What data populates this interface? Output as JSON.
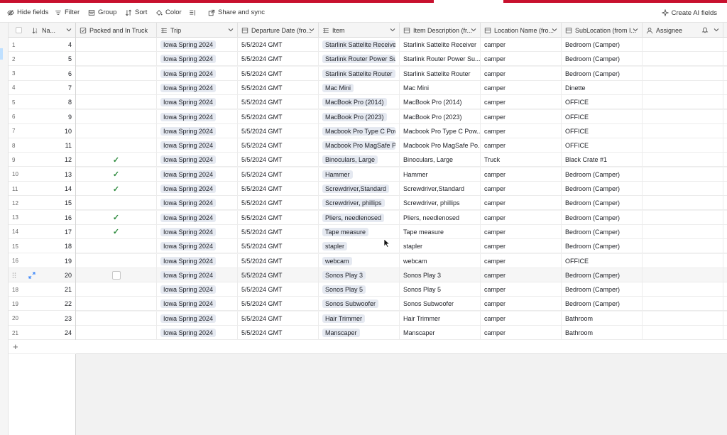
{
  "toolbar": {
    "hide_fields": "Hide fields",
    "filter": "Filter",
    "group": "Group",
    "sort": "Sort",
    "color": "Color",
    "share": "Share and sync",
    "create_ai": "Create AI fields"
  },
  "columns": {
    "name": "Na...",
    "packed": "Packed and In Truck",
    "trip": "Trip",
    "date": "Departure Date (fro...",
    "item": "Item",
    "desc": "Item Description (fr...",
    "loc": "Location Name (fro...",
    "sub": "SubLocation (from I...",
    "asg": "Assignee"
  },
  "rows": [
    {
      "idx": "1",
      "name": "4",
      "packed": false,
      "trip": "Iowa Spring 2024",
      "date": "5/5/2024 GMT",
      "item": "Starlink Sattelite Receiver",
      "desc": "Starlink Sattelite Receiver",
      "loc": "camper",
      "sub": "Bedroom (Camper)"
    },
    {
      "idx": "2",
      "name": "5",
      "packed": false,
      "trip": "Iowa Spring 2024",
      "date": "5/5/2024 GMT",
      "item": "Starlink Router Power Suppl",
      "desc": "Starlink Router Power Su...",
      "loc": "camper",
      "sub": "Bedroom (Camper)"
    },
    {
      "idx": "3",
      "name": "6",
      "packed": false,
      "trip": "Iowa Spring 2024",
      "date": "5/5/2024 GMT",
      "item": "Starlink Sattelite Router",
      "desc": "Starlink Sattelite Router",
      "loc": "camper",
      "sub": "Bedroom (Camper)"
    },
    {
      "idx": "4",
      "name": "7",
      "packed": false,
      "trip": "Iowa Spring 2024",
      "date": "5/5/2024 GMT",
      "item": "Mac Mini",
      "desc": "Mac Mini",
      "loc": "camper",
      "sub": "Dinette"
    },
    {
      "idx": "5",
      "name": "8",
      "packed": false,
      "trip": "Iowa Spring 2024",
      "date": "5/5/2024 GMT",
      "item": "MacBook Pro (2014)",
      "desc": "MacBook Pro (2014)",
      "loc": "camper",
      "sub": "OFFICE"
    },
    {
      "idx": "6",
      "name": "9",
      "packed": false,
      "trip": "Iowa Spring 2024",
      "date": "5/5/2024 GMT",
      "item": "MacBook Pro (2023)",
      "desc": "MacBook Pro (2023)",
      "loc": "camper",
      "sub": "OFFICE"
    },
    {
      "idx": "7",
      "name": "10",
      "packed": false,
      "trip": "Iowa Spring 2024",
      "date": "5/5/2024 GMT",
      "item": "Macbook Pro Type C Power",
      "desc": "Macbook Pro Type C Pow...",
      "loc": "camper",
      "sub": "OFFICE"
    },
    {
      "idx": "8",
      "name": "11",
      "packed": false,
      "trip": "Iowa Spring 2024",
      "date": "5/5/2024 GMT",
      "item": "Macbook Pro MagSafe Pow",
      "desc": "Macbook Pro MagSafe Po...",
      "loc": "camper",
      "sub": "OFFICE"
    },
    {
      "idx": "9",
      "name": "12",
      "packed": true,
      "trip": "Iowa Spring 2024",
      "date": "5/5/2024 GMT",
      "item": "Binoculars, Large",
      "desc": "Binoculars, Large",
      "loc": "Truck",
      "sub": "Black Crate #1"
    },
    {
      "idx": "10",
      "name": "13",
      "packed": true,
      "trip": "Iowa Spring 2024",
      "date": "5/5/2024 GMT",
      "item": "Hammer",
      "desc": "Hammer",
      "loc": "camper",
      "sub": "Bedroom (Camper)"
    },
    {
      "idx": "11",
      "name": "14",
      "packed": true,
      "trip": "Iowa Spring 2024",
      "date": "5/5/2024 GMT",
      "item": "Screwdriver,Standard",
      "desc": "Screwdriver,Standard",
      "loc": "camper",
      "sub": "Bedroom (Camper)"
    },
    {
      "idx": "12",
      "name": "15",
      "packed": false,
      "trip": "Iowa Spring 2024",
      "date": "5/5/2024 GMT",
      "item": "Screwdriver, phillips",
      "desc": "Screwdriver, phillips",
      "loc": "camper",
      "sub": "Bedroom (Camper)"
    },
    {
      "idx": "13",
      "name": "16",
      "packed": true,
      "trip": "Iowa Spring 2024",
      "date": "5/5/2024 GMT",
      "item": "Pliers, needlenosed",
      "desc": "Pliers, needlenosed",
      "loc": "camper",
      "sub": "Bedroom (Camper)"
    },
    {
      "idx": "14",
      "name": "17",
      "packed": true,
      "trip": "Iowa Spring 2024",
      "date": "5/5/2024 GMT",
      "item": "Tape measure",
      "desc": "Tape measure",
      "loc": "camper",
      "sub": "Bedroom (Camper)"
    },
    {
      "idx": "15",
      "name": "18",
      "packed": false,
      "trip": "Iowa Spring 2024",
      "date": "5/5/2024 GMT",
      "item": "stapler",
      "desc": "stapler",
      "loc": "camper",
      "sub": "Bedroom (Camper)"
    },
    {
      "idx": "16",
      "name": "19",
      "packed": false,
      "trip": "Iowa Spring 2024",
      "date": "5/5/2024 GMT",
      "item": "webcam",
      "desc": "webcam",
      "loc": "camper",
      "sub": "OFFICE"
    },
    {
      "idx": "",
      "name": "20",
      "packed": false,
      "hover": true,
      "trip": "Iowa Spring 2024",
      "date": "5/5/2024 GMT",
      "item": "Sonos Play 3",
      "desc": "Sonos Play 3",
      "loc": "camper",
      "sub": "Bedroom (Camper)"
    },
    {
      "idx": "18",
      "name": "21",
      "packed": false,
      "trip": "Iowa Spring 2024",
      "date": "5/5/2024 GMT",
      "item": "Sonos Play 5",
      "desc": "Sonos Play 5",
      "loc": "camper",
      "sub": "Bedroom (Camper)"
    },
    {
      "idx": "19",
      "name": "22",
      "packed": false,
      "trip": "Iowa Spring 2024",
      "date": "5/5/2024 GMT",
      "item": "Sonos Subwoofer",
      "desc": "Sonos Subwoofer",
      "loc": "camper",
      "sub": "Bedroom (Camper)"
    },
    {
      "idx": "20",
      "name": "23",
      "packed": false,
      "trip": "Iowa Spring 2024",
      "date": "5/5/2024 GMT",
      "item": "Hair Trimmer",
      "desc": "Hair Trimmer",
      "loc": "camper",
      "sub": "Bathroom"
    },
    {
      "idx": "21",
      "name": "24",
      "packed": false,
      "trip": "Iowa Spring 2024",
      "date": "5/5/2024 GMT",
      "item": "Manscaper",
      "desc": "Manscaper",
      "loc": "camper",
      "sub": "Bathroom"
    }
  ],
  "add_row_label": "+",
  "colors": {
    "accent_red": "#c8102e",
    "check_green": "#2e8b3e",
    "pill_bg": "#e5e9f1"
  }
}
